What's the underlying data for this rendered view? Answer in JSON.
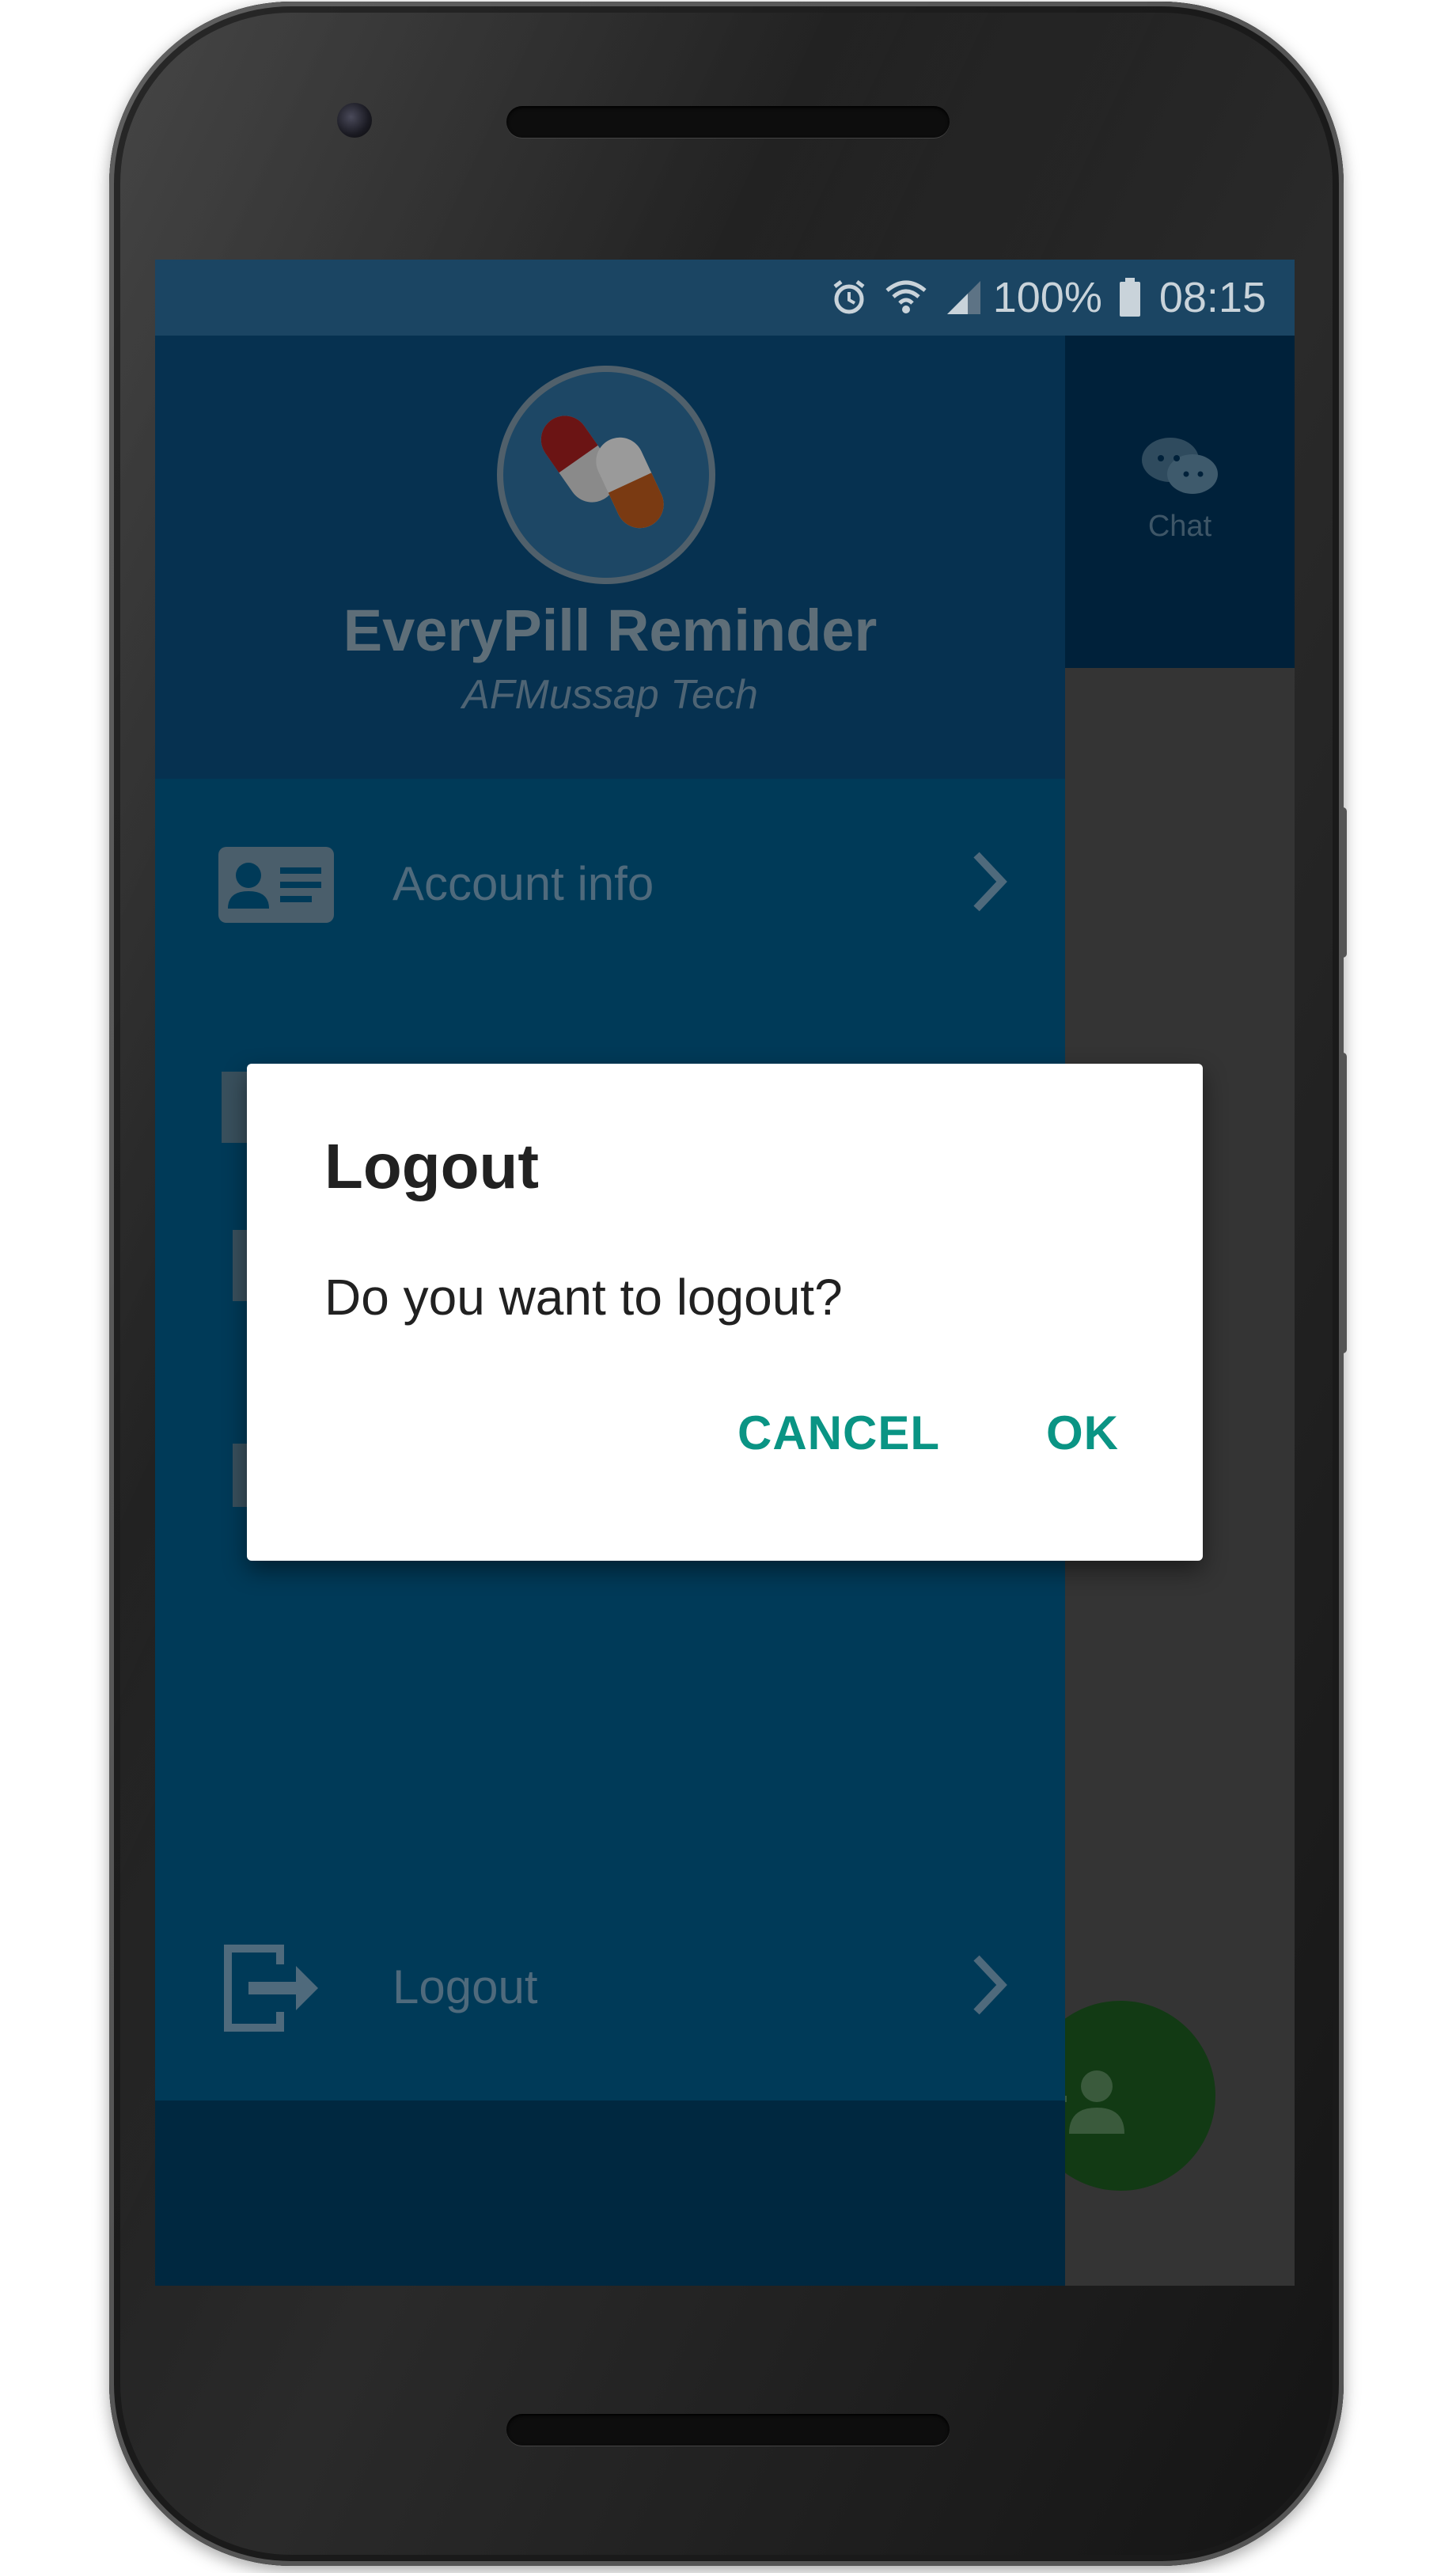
{
  "status_bar": {
    "battery_text": "100%",
    "time": "08:15",
    "icons": [
      "alarm-icon",
      "wifi-icon",
      "signal-icon",
      "battery-icon"
    ]
  },
  "drawer": {
    "app_title": "EveryPill Reminder",
    "app_subtitle": "AFMussap Tech",
    "items": [
      {
        "label": "Account info",
        "icon": "id-card-icon"
      },
      {
        "label": "Logout",
        "icon": "logout-icon"
      }
    ]
  },
  "background_tab": {
    "label": "Chat",
    "icon": "chat-bubbles-icon"
  },
  "fab": {
    "icon": "add-person-icon"
  },
  "dialog": {
    "title": "Logout",
    "message": "Do you want to logout?",
    "cancel_label": "CANCEL",
    "ok_label": "OK"
  },
  "colors": {
    "accent": "#0a9484",
    "drawer_bg": "#003a58",
    "status_bar": "#1b4563"
  }
}
